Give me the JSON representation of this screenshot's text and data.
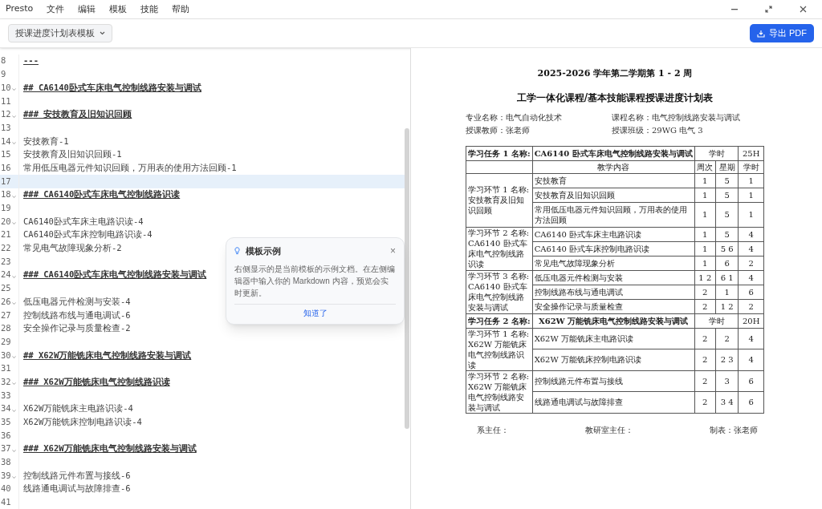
{
  "app": {
    "title": "Presto",
    "menu": [
      "文件",
      "编辑",
      "模板",
      "技能",
      "帮助"
    ]
  },
  "toolbar": {
    "template": "授课进度计划表模板",
    "export": "导出 PDF"
  },
  "editor": {
    "lines": [
      {
        "number": "8",
        "text": "---",
        "kind": "heading",
        "foldable": false,
        "selected": false
      },
      {
        "number": "9",
        "kind": "blank",
        "foldable": false,
        "selected": false
      },
      {
        "number": "10",
        "text": "## CA6140卧式车床电气控制线路安装与调试",
        "kind": "heading",
        "foldable": true,
        "selected": false
      },
      {
        "number": "11",
        "kind": "blank",
        "foldable": false,
        "selected": false
      },
      {
        "number": "12",
        "text": "### 安技教育及旧知识回顾",
        "kind": "heading",
        "foldable": true,
        "selected": false
      },
      {
        "number": "13",
        "kind": "blank",
        "foldable": false,
        "selected": false
      },
      {
        "number": "14",
        "text": "安技教育-1",
        "kind": "text",
        "foldable": true,
        "selected": false
      },
      {
        "number": "15",
        "text": "安技教育及旧知识回顾-1",
        "kind": "text",
        "foldable": false,
        "selected": false
      },
      {
        "number": "16",
        "text": "常用低压电器元件知识回顾，万用表的使用方法回顾-1",
        "kind": "text",
        "foldable": false,
        "selected": false
      },
      {
        "number": "17",
        "kind": "blank",
        "foldable": false,
        "selected": true
      },
      {
        "number": "18",
        "text": "### CA6140卧式车床电气控制线路识读",
        "kind": "heading",
        "foldable": true,
        "selected": false
      },
      {
        "number": "19",
        "kind": "blank",
        "foldable": false,
        "selected": false
      },
      {
        "number": "20",
        "text": "CA6140卧式车床主电路识读-4",
        "kind": "text",
        "foldable": true,
        "selected": false
      },
      {
        "number": "21",
        "text": "CA6140卧式车床控制电路识读-4",
        "kind": "text",
        "foldable": false,
        "selected": false
      },
      {
        "number": "22",
        "text": "常见电气故障现象分析-2",
        "kind": "text",
        "foldable": false,
        "selected": false
      },
      {
        "number": "23",
        "kind": "blank",
        "foldable": false,
        "selected": false
      },
      {
        "number": "24",
        "text": "### CA6140卧式车床电气控制线路安装与调试",
        "kind": "heading",
        "foldable": true,
        "selected": false
      },
      {
        "number": "25",
        "kind": "blank",
        "foldable": false,
        "selected": false
      },
      {
        "number": "26",
        "text": "低压电器元件检测与安装-4",
        "kind": "text",
        "foldable": true,
        "selected": false
      },
      {
        "number": "27",
        "text": "控制线路布线与通电调试-6",
        "kind": "text",
        "foldable": false,
        "selected": false
      },
      {
        "number": "28",
        "text": "安全操作记录与质量检查-2",
        "kind": "text",
        "foldable": false,
        "selected": false
      },
      {
        "number": "29",
        "kind": "blank",
        "foldable": false,
        "selected": false
      },
      {
        "number": "30",
        "text": "## X62W万能铣床电气控制线路安装与调试",
        "kind": "heading",
        "foldable": true,
        "selected": false
      },
      {
        "number": "31",
        "kind": "blank",
        "foldable": false,
        "selected": false
      },
      {
        "number": "32",
        "text": "### X62W万能铣床电气控制线路识读",
        "kind": "heading",
        "foldable": true,
        "selected": false
      },
      {
        "number": "33",
        "kind": "blank",
        "foldable": false,
        "selected": false
      },
      {
        "number": "34",
        "text": "X62W万能铣床主电路识读-4",
        "kind": "text",
        "foldable": true,
        "selected": false
      },
      {
        "number": "35",
        "text": "X62W万能铣床控制电路识读-4",
        "kind": "text",
        "foldable": false,
        "selected": false
      },
      {
        "number": "36",
        "kind": "blank",
        "foldable": false,
        "selected": false
      },
      {
        "number": "37",
        "text": "### X62W万能铣床电气控制线路安装与调试",
        "kind": "heading",
        "foldable": true,
        "selected": false
      },
      {
        "number": "38",
        "kind": "blank",
        "foldable": false,
        "selected": false
      },
      {
        "number": "39",
        "text": "控制线路元件布置与接线-6",
        "kind": "text",
        "foldable": true,
        "selected": false
      },
      {
        "number": "40",
        "text": "线路通电调试与故障排查-6",
        "kind": "text",
        "foldable": false,
        "selected": false
      },
      {
        "number": "41",
        "kind": "blank",
        "foldable": false,
        "selected": false
      }
    ]
  },
  "popover": {
    "title": "模板示例",
    "body": "右侧显示的是当前模板的示例文档。在左侧编辑器中输入你的 Markdown 内容，预览会实时更新。",
    "close": "×",
    "button": "知道了"
  },
  "preview": {
    "title": "2025-2026 学年第二学期第 1 - 2 周",
    "subtitle": "工学一体化课程/基本技能课程授课进度计划表",
    "meta": [
      {
        "label": "专业名称：",
        "value": "电气自动化技术"
      },
      {
        "label": "课程名称：",
        "value": "电气控制线路安装与调试"
      },
      {
        "label": "授课教师：",
        "value": "张老师"
      },
      {
        "label": "授课班级：",
        "value": "29WG 电气 3"
      }
    ],
    "columns": [
      "教学内容",
      "周次",
      "星期",
      "学时"
    ],
    "tasks": [
      {
        "label": "学习任务 1 名称:",
        "name": "CA6140 卧式车床电气控制线路安装与调试",
        "hours_label": "学时",
        "hours": "25H",
        "sections": [
          {
            "label": "学习环节 1 名称: 安技教育及旧知识回顾",
            "items": [
              {
                "content": "安技教育",
                "week": "1",
                "day": "5",
                "hours": "1"
              },
              {
                "content": "安技教育及旧知识回顾",
                "week": "1",
                "day": "5",
                "hours": "1"
              },
              {
                "content": "常用低压电器元件知识回顾，万用表的使用方法回顾",
                "week": "1",
                "day": "5",
                "hours": "1"
              }
            ]
          },
          {
            "label": "学习环节 2 名称: CA6140 卧式车床电气控制线路识读",
            "items": [
              {
                "content": "CA6140 卧式车床主电路识读",
                "week": "1",
                "day": "5",
                "hours": "4"
              },
              {
                "content": "CA6140 卧式车床控制电路识读",
                "week": "1",
                "day": "5 6",
                "hours": "4"
              },
              {
                "content": "常见电气故障现象分析",
                "week": "1",
                "day": "6",
                "hours": "2"
              }
            ]
          },
          {
            "label": "学习环节 3 名称: CA6140 卧式车床电气控制线路安装与调试",
            "items": [
              {
                "content": "低压电器元件检测与安装",
                "week": "1 2",
                "day": "6 1",
                "hours": "4"
              },
              {
                "content": "控制线路布线与通电调试",
                "week": "2",
                "day": "1",
                "hours": "6"
              },
              {
                "content": "安全操作记录与质量检查",
                "week": "2",
                "day": "1 2",
                "hours": "2"
              }
            ]
          }
        ]
      },
      {
        "label": "学习任务 2 名称:",
        "name": "X62W 万能铣床电气控制线路安装与调试",
        "hours_label": "学时",
        "hours": "20H",
        "sections": [
          {
            "label": "学习环节 1 名称: X62W 万能铣床电气控制线路识读",
            "items": [
              {
                "content": "X62W 万能铣床主电路识读",
                "week": "2",
                "day": "2",
                "hours": "4"
              },
              {
                "content": "X62W 万能铣床控制电路识读",
                "week": "2",
                "day": "2 3",
                "hours": "4"
              }
            ]
          },
          {
            "label": "学习环节 2 名称: X62W 万能铣床电气控制线路安装与调试",
            "items": [
              {
                "content": "控制线路元件布置与接线",
                "week": "2",
                "day": "3",
                "hours": "6"
              },
              {
                "content": "线路通电调试与故障排查",
                "week": "2",
                "day": "3 4",
                "hours": "6"
              }
            ]
          }
        ]
      }
    ],
    "signatures": [
      "系主任：",
      "教研室主任：",
      "制表：张老师"
    ]
  }
}
